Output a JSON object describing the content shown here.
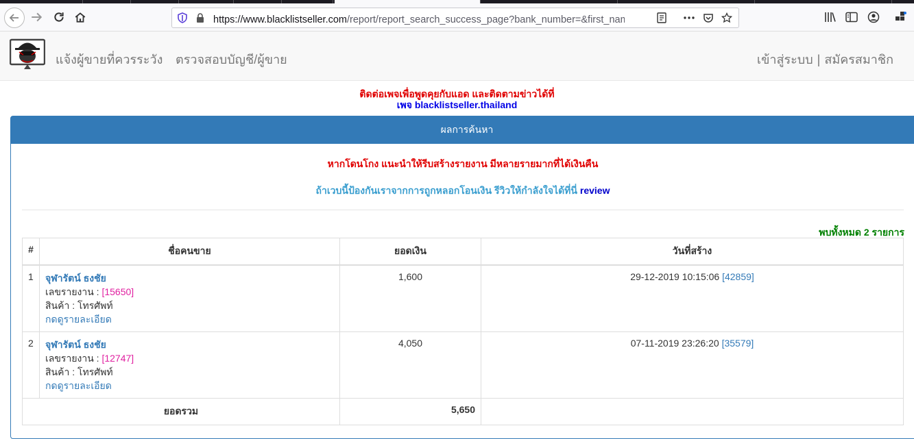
{
  "browser": {
    "url_host": "https://www.blacklistseller.com",
    "url_path": "/report/report_search_success_page?bank_number=&first_name=จุฬ"
  },
  "site": {
    "nav": {
      "report_seller": "แจ้งผู้ขายที่ควรระวัง",
      "check_account": "ตรวจสอบบัญชี/ผู้ขาย",
      "login": "เข้าสู่ระบบ",
      "separator": "|",
      "register": "สมัครสมาชิก"
    },
    "announce": {
      "line1": "ติดต่อเพจเพื่อพูดคุยกับแอด และติดตามข่าวได้ที่",
      "line2": "เพจ blacklistseller.thailand"
    }
  },
  "panel": {
    "title": "ผลการค้นหา",
    "warning": "หากโดนโกง แนะนำให้รีบสร้างรายงาน มีหลายรายมากที่ได้เงินคืน",
    "review_text": "ถ้าเวบนี้ป้องกันเราจากการถูกหลอกโอนเงิน รีวิวให้กำลังใจได้ที่นี่",
    "review_link": "review",
    "found_text": "พบทั้งหมด 2 รายการ"
  },
  "table": {
    "headers": [
      "#",
      "ชื่อคนขาย",
      "ยอดเงิน",
      "วันที่สร้าง"
    ],
    "rows": [
      {
        "num": "1",
        "seller": "จุฬารัตน์ ธงชัย",
        "report_label": "เลขรายงาน : ",
        "report_id": "[15650]",
        "product_label": "สินค้า : โทรศัพท์",
        "detail_link": "กดดูรายละเอียด",
        "amount": "1,600",
        "date": "29-12-2019 10:15:06",
        "date_ref": "[42859]"
      },
      {
        "num": "2",
        "seller": "จุฬารัตน์ ธงชัย",
        "report_label": "เลขรายงาน : ",
        "report_id": "[12747]",
        "product_label": "สินค้า : โทรศัพท์",
        "detail_link": "กดดูรายละเอียด",
        "amount": "4,050",
        "date": "07-11-2019 23:26:20",
        "date_ref": "[35579]"
      }
    ],
    "total_label": "ยอดรวม",
    "total_value": "5,650"
  }
}
